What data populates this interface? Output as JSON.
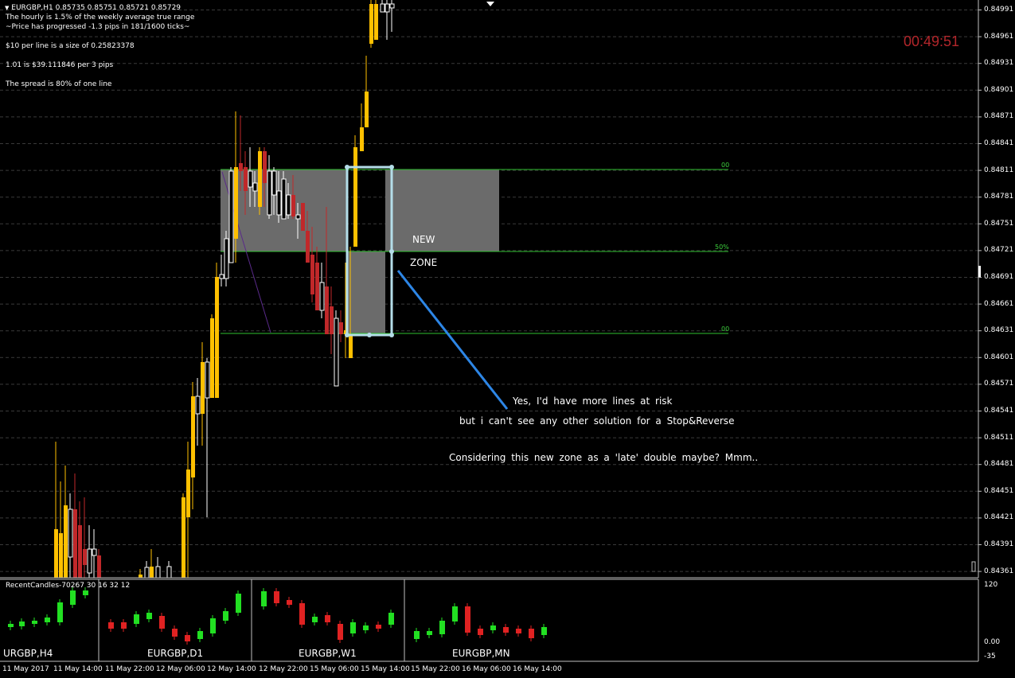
{
  "header": {
    "symbol_line": "EURGBP,H1  0.85735 0.85751 0.85721 0.85729",
    "info_lines": [
      "The hourly is 1.5% of the weekly average true range",
      "~Price has progressed  -1.3  pips in 181/1600 ticks~",
      "$10 per line is a size of 0.25823378",
      "1.01 is $39.111846 per 3 pips",
      "The spread is 80% of one line"
    ]
  },
  "timer": "00:49:51",
  "zone_labels": {
    "new": "NEW",
    "zone": "ZONE"
  },
  "fibo_labels": [
    "00",
    "50%",
    "00"
  ],
  "annotations": [
    "Yes, I'd have more lines at risk",
    "but i can't see any other solution for a Stop&Reverse",
    "Considering this new zone as a 'late' double maybe? Mmm.."
  ],
  "price_axis": [
    "0.84991",
    "0.84961",
    "0.84931",
    "0.84901",
    "0.84871",
    "0.84841",
    "0.84811",
    "0.84781",
    "0.84751",
    "0.84721",
    "0.84691",
    "0.84661",
    "0.84631",
    "0.84601",
    "0.84571",
    "0.84541",
    "0.84511",
    "0.84481",
    "0.84451",
    "0.84421",
    "0.84391",
    "0.84361"
  ],
  "subwindow": {
    "indicator_label": "RecentCandles-70267 30 16 32 12",
    "scale_top": "120",
    "scale_zero": "0.00",
    "scale_bottom": "-35",
    "panels": [
      "URGBP,H4",
      "EURGBP,D1",
      "EURGBP,W1",
      "EURGBP,MN"
    ]
  },
  "time_axis": [
    "11 May 2017",
    "11 May 14:00",
    "11 May 22:00",
    "12 May 06:00",
    "12 May 14:00",
    "12 May 22:00",
    "15 May 06:00",
    "15 May 14:00",
    "15 May 22:00",
    "16 May 06:00",
    "16 May 14:00"
  ],
  "colors": {
    "bull_candle": "#ffc000",
    "bear_candle": "#c0282a",
    "zone_fill": "#6b6b6b",
    "fibo_line": "#2fbf2f",
    "box_outline": "#b4dde8",
    "arrow_line": "#2d86e6",
    "sub_bull": "#22e022",
    "sub_bear": "#e02222"
  }
}
